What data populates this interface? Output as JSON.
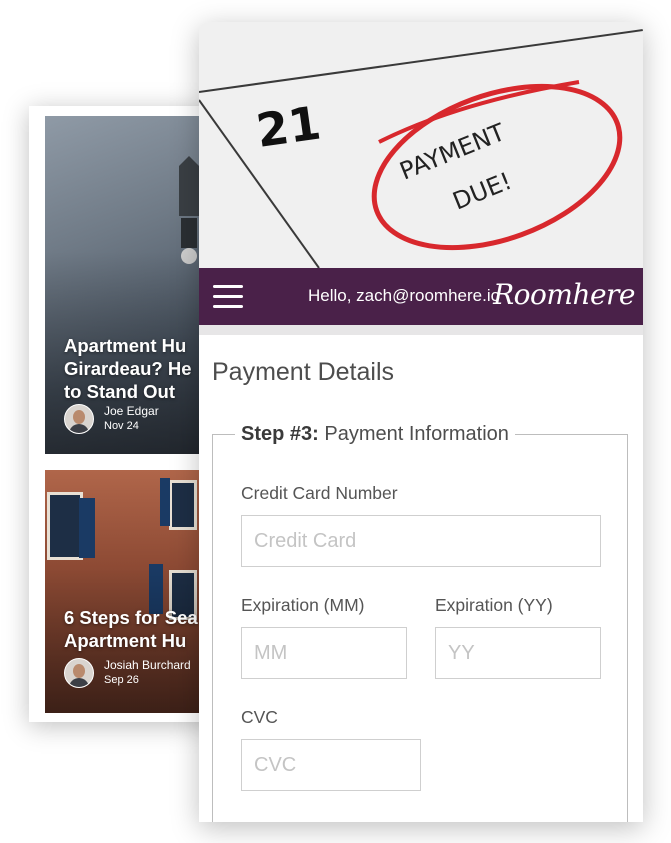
{
  "blog": {
    "posts": [
      {
        "title": "Apartment Hu\nGirardeau? He\nto Stand Out",
        "author": "Joe Edgar",
        "date": "Nov 24"
      },
      {
        "title": "6 Steps for Sea\nApartment Hu",
        "author": "Josiah Burchard",
        "date": "Sep 26"
      }
    ]
  },
  "hero": {
    "calendar_day": "21",
    "note_line1": "PAYMENT",
    "note_line2": "DUE!"
  },
  "navbar": {
    "greeting": "Hello, zach@roomhere.io",
    "brand": "Roomhere",
    "color": "#4a2149"
  },
  "page": {
    "title": "Payment Details"
  },
  "form": {
    "legend_step": "Step #3:",
    "legend_text": " Payment Information",
    "credit_card": {
      "label": "Credit Card Number",
      "placeholder": "Credit Card"
    },
    "exp_mm": {
      "label": "Expiration (MM)",
      "placeholder": "MM"
    },
    "exp_yy": {
      "label": "Expiration (YY)",
      "placeholder": "YY"
    },
    "cvc": {
      "label": "CVC",
      "placeholder": "CVC"
    }
  },
  "icons": {
    "menu": "hamburger-menu-icon"
  }
}
